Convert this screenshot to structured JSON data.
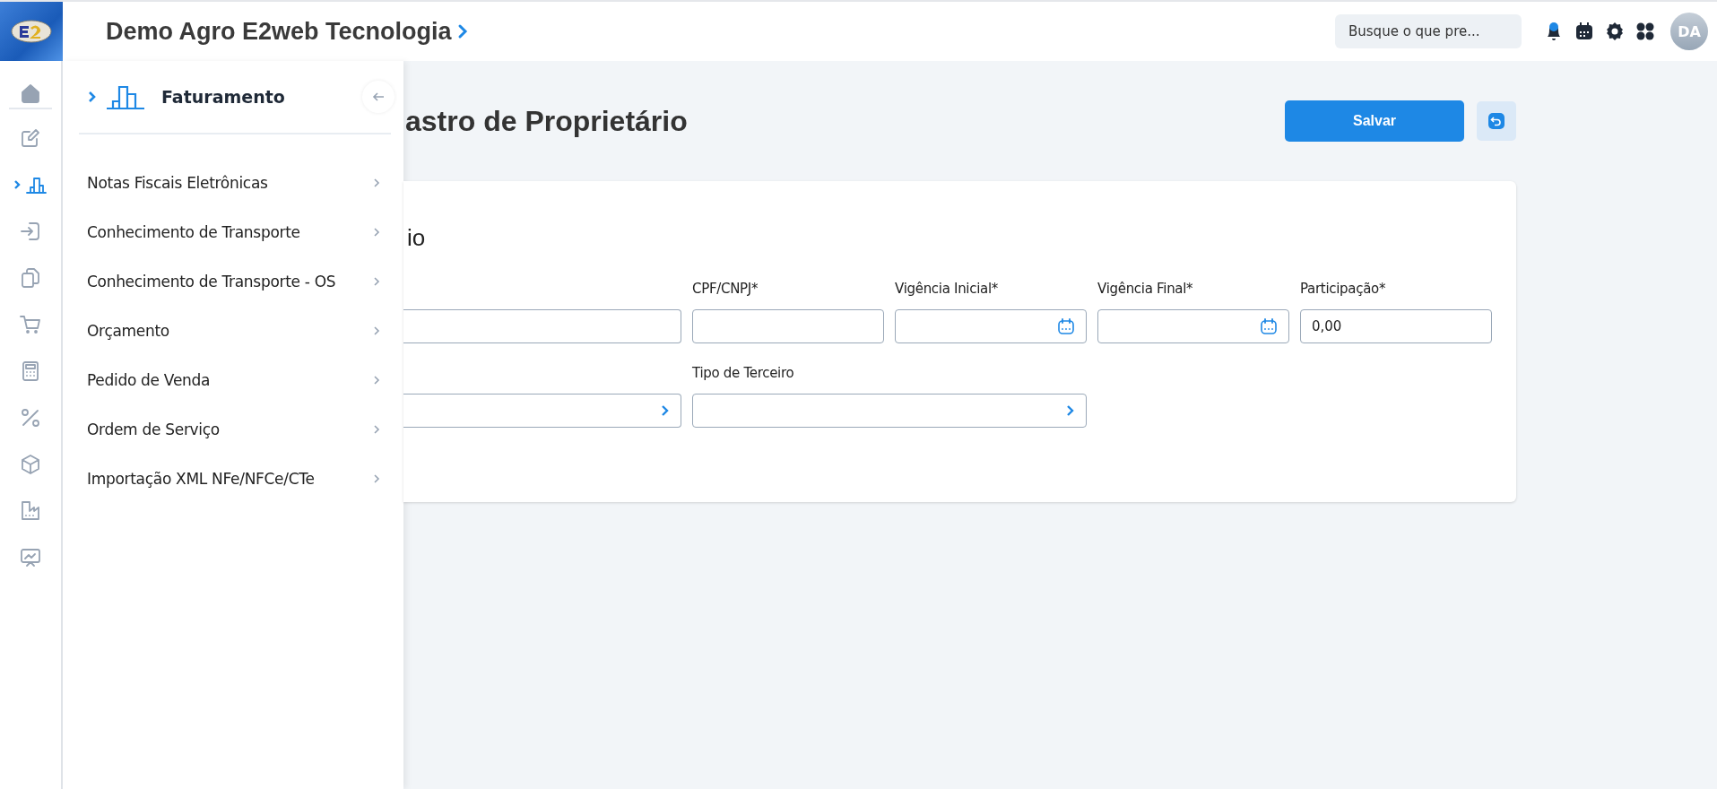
{
  "topbar": {
    "company": "Demo Agro E2web Tecnologia",
    "search": {
      "placeholder": "Busque o que pre..."
    },
    "notifications": {
      "unread": true
    },
    "avatar": "DA"
  },
  "rail": [
    {
      "selected": false
    },
    {
      "selected": false
    },
    {
      "selected": true
    },
    {
      "selected": false
    },
    {
      "selected": false
    },
    {
      "selected": false
    },
    {
      "selected": false
    },
    {
      "selected": false
    },
    {
      "selected": false
    },
    {
      "selected": false
    },
    {
      "selected": false
    }
  ],
  "flyout": {
    "title": "Faturamento",
    "items": [
      {
        "label": "Notas Fiscais Eletrônicas"
      },
      {
        "label": "Conhecimento de Transporte"
      },
      {
        "label": "Conhecimento de Transporte - OS"
      },
      {
        "label": "Orçamento"
      },
      {
        "label": "Pedido de Venda"
      },
      {
        "label": "Ordem de Serviço"
      },
      {
        "label": "Importação XML NFe/NFCe/CTe"
      }
    ]
  },
  "page": {
    "title": "astro de Proprietário",
    "save": "Salvar"
  },
  "card": {
    "title": "io",
    "rows": [
      [
        {
          "kind": "text"
        },
        {
          "kind": "text",
          "label": "CPF/CNPJ*"
        },
        {
          "kind": "date",
          "label": "Vigência Inicial*"
        },
        {
          "kind": "date",
          "label": "Vigência Final*"
        },
        {
          "kind": "text",
          "label": "Participação*",
          "value": "0,00"
        }
      ],
      [
        {
          "kind": "select"
        },
        {
          "kind": "select",
          "label": "Tipo de Terceiro"
        }
      ]
    ]
  }
}
